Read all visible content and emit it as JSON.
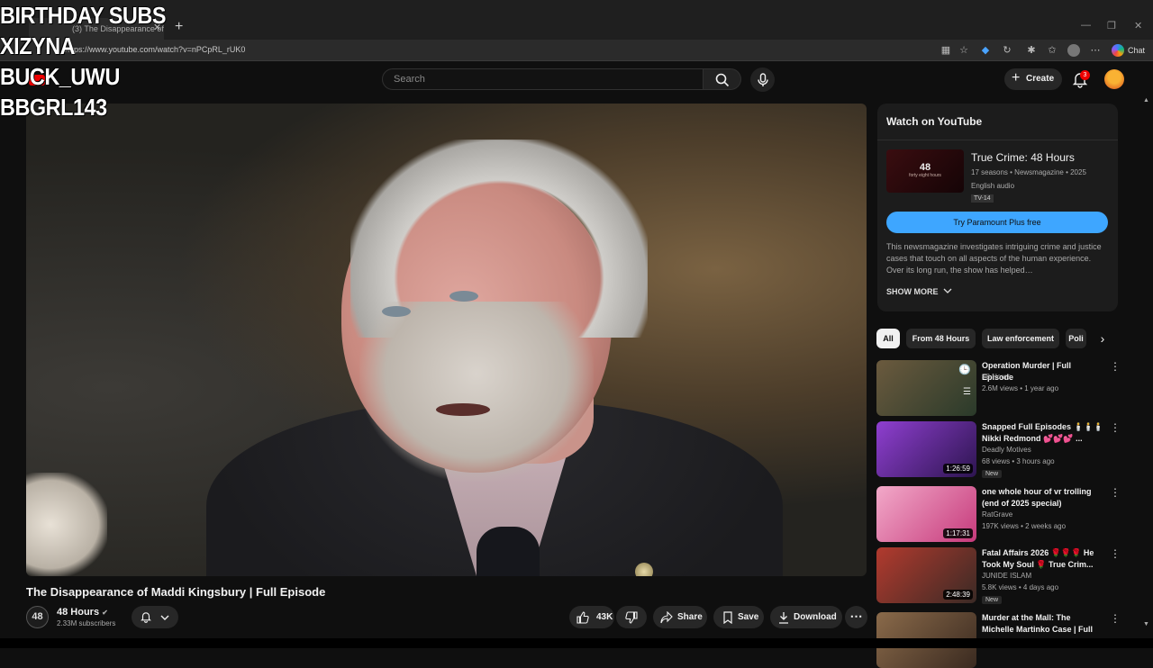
{
  "browser": {
    "tab_title": "(3) The Disappearance of Ma",
    "tab_close": "✕",
    "new_tab": "+",
    "url": "https://www.youtube.com/watch?v=nPCpRL_rUK0",
    "chat_label": "Chat",
    "window_controls": [
      "—",
      "❐",
      "✕"
    ]
  },
  "overlay": {
    "lines": [
      "BIRTHDAY SUBS",
      "XIZYNA",
      "BUCK_UWU",
      "BBGRL143"
    ]
  },
  "header": {
    "search_placeholder": "Search",
    "create_label": "Create",
    "notification_count": "3"
  },
  "video": {
    "title": "The Disappearance of Maddi Kingsbury | Full Episode",
    "channel_name": "48 Hours",
    "channel_avatar_text": "48",
    "subscribers": "2.33M subscribers",
    "like_count": "43K",
    "share_label": "Share",
    "save_label": "Save",
    "download_label": "Download"
  },
  "watch_card": {
    "heading": "Watch on YouTube",
    "show_title": "True Crime: 48 Hours",
    "thumb_text": "48",
    "thumb_caption": "forty eight hours",
    "meta": "17 seasons • Newsmagazine • 2025",
    "audio": "English audio",
    "rating": "TV-14",
    "cta": "Try Paramount Plus free",
    "description": "This newsmagazine investigates intriguing crime and justice cases that touch on all aspects of the human experience. Over its long run, the show has helped…",
    "show_more": "SHOW MORE"
  },
  "chips": [
    "All",
    "From 48 Hours",
    "Law enforcement",
    "Poli"
  ],
  "recommendations": [
    {
      "title": "Operation Murder | Full Episode",
      "channel": "48 Hours",
      "stats": "2.6M views • 1 year ago",
      "duration": "",
      "badge": "",
      "thumb": [
        "#6b5a3e",
        "#2a3a2a"
      ]
    },
    {
      "title": "Snapped Full Episodes 🕯️🕯️🕯️ Nikki Redmond 💕💕💕 ...",
      "channel": "Deadly Motives",
      "stats": "68 views • 3 hours ago",
      "duration": "1:26:59",
      "badge": "New",
      "thumb": [
        "#8f3fd0",
        "#2d1550"
      ]
    },
    {
      "title": "one whole hour of vr trolling (end of 2025 special)",
      "channel": "RatGrave",
      "stats": "197K views • 2 weeks ago",
      "duration": "1:17:31",
      "badge": "",
      "thumb": [
        "#f2a9c9",
        "#c63a7b"
      ]
    },
    {
      "title": "Fatal Affairs 2026 🌹🌹🌹 He Took My Soul 🌹 True Crim...",
      "channel": "JUNIDE ISLAM",
      "stats": "5.8K views • 4 days ago",
      "duration": "2:48:39",
      "badge": "New",
      "thumb": [
        "#b23a2e",
        "#3a2a25"
      ]
    },
    {
      "title": "Murder at the Mall: The Michelle Martinko Case | Full Episode",
      "channel": "",
      "stats": "",
      "duration": "",
      "badge": "",
      "thumb": [
        "#8a6a4a",
        "#3a2a20"
      ]
    }
  ]
}
